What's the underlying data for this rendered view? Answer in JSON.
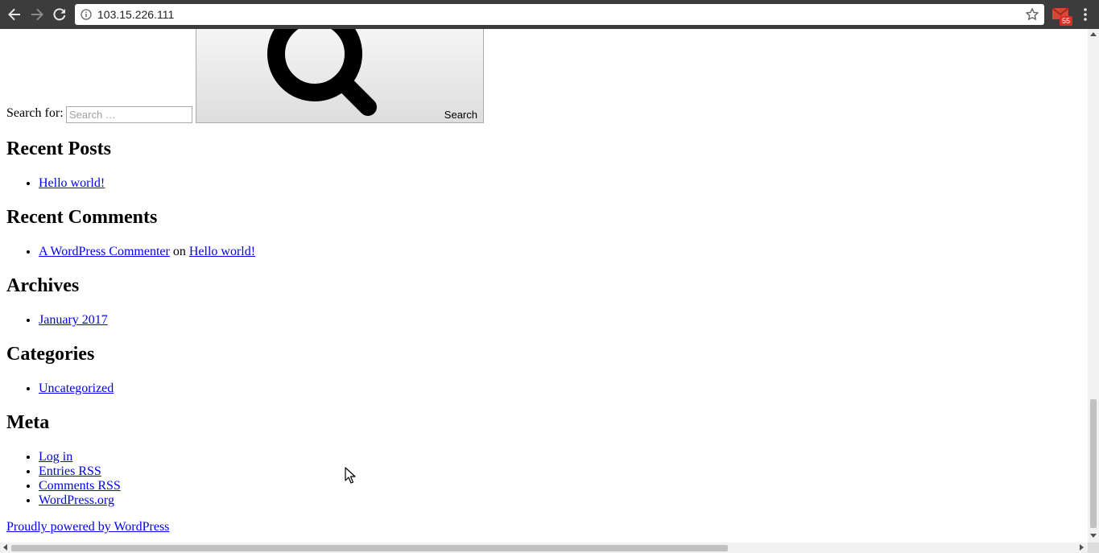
{
  "browser": {
    "url": "103.15.226.111",
    "extension_badge": "55"
  },
  "search": {
    "label": "Search for:",
    "placeholder": "Search …",
    "button_label": "Search"
  },
  "recent_posts": {
    "heading": "Recent Posts",
    "items": [
      "Hello world!"
    ]
  },
  "recent_comments": {
    "heading": "Recent Comments",
    "author": "A WordPress Commenter",
    "connector": "on",
    "post": "Hello world!"
  },
  "archives": {
    "heading": "Archives",
    "items": [
      "January 2017"
    ]
  },
  "categories": {
    "heading": "Categories",
    "items": [
      "Uncategorized"
    ]
  },
  "meta": {
    "heading": "Meta",
    "items": [
      "Log in",
      "Entries RSS",
      "Comments RSS",
      "WordPress.org"
    ]
  },
  "footer": {
    "credit": "Proudly powered by WordPress"
  }
}
